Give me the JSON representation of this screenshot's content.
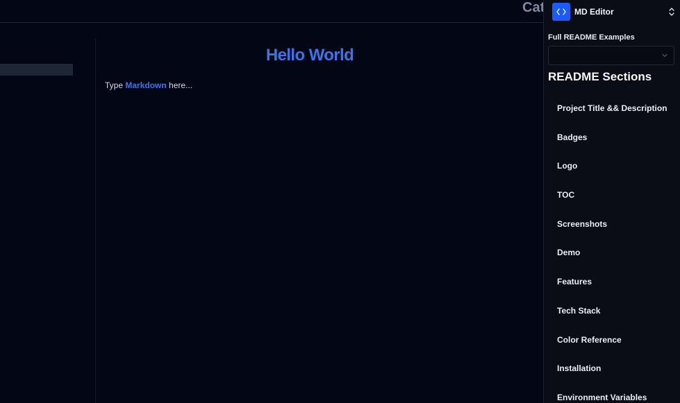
{
  "header": {
    "title": "Cat"
  },
  "preview": {
    "heading": "Hello World",
    "paragraph_before": "Type ",
    "paragraph_link": "Markdown",
    "paragraph_after": " here..."
  },
  "sidebar": {
    "app_name": "MD Editor",
    "examples_label": "Full README Examples",
    "examples_value": "",
    "sections_title": "README Sections",
    "sections": [
      "Project Title && Description",
      "Badges",
      "Logo",
      "TOC",
      "Screenshots",
      "Demo",
      "Features",
      "Tech Stack",
      "Color Reference",
      "Installation",
      "Environment Variables"
    ]
  },
  "icons": {
    "logo": "code-brackets-icon",
    "toggle": "chevron-up-down-icon",
    "select": "chevron-down-icon"
  },
  "colors": {
    "background": "#030614",
    "sidebar_background": "#0a0d16",
    "accent": "#1a5cf5",
    "heading": "#3b74e8"
  }
}
